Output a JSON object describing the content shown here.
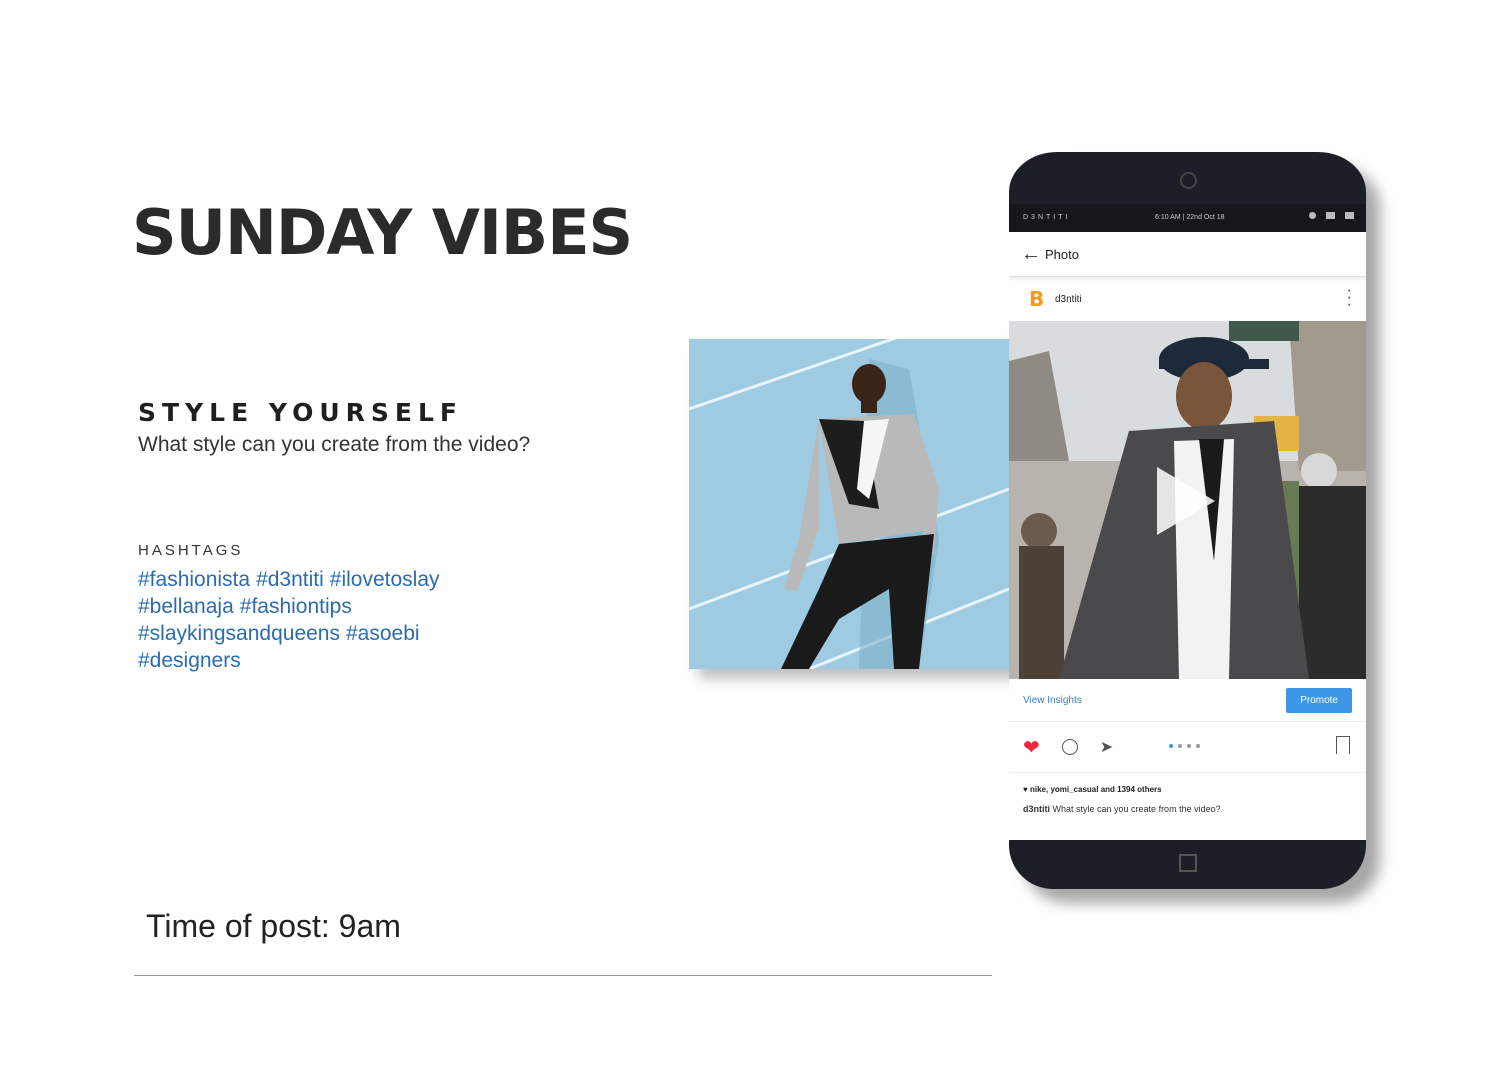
{
  "page": {
    "title": "SUNDAY VIBES",
    "subtitle": "STYLE YOURSELF",
    "question": "What style can you create from the video?",
    "hashtags_label": "HASHTAGS",
    "hashtags": [
      "#fashionista",
      "#d3ntiti",
      "#ilovetoslay",
      "#bellanaja",
      "#fashiontips",
      "#slaykingsandqueens",
      "#asoebi",
      "#designers"
    ],
    "time_of_post": "Time of post: 9am"
  },
  "phone": {
    "status_brand": "D3NTITI",
    "status_time": "6:10 AM | 22nd Oct 18",
    "app_title": "Photo",
    "username": "d3ntiti",
    "logo_letter": "B",
    "view_insights": "View Insights",
    "promote": "Promote",
    "likes_text": "nike, yomi_casual and 1394 others",
    "caption_user": "d3ntiti",
    "caption_text": "What style can you create from the video?"
  },
  "colors": {
    "hashtag": "#2b6cb0",
    "promote": "#3d96e8",
    "heart": "#ed2a3a",
    "logo": "#f39a1e"
  }
}
